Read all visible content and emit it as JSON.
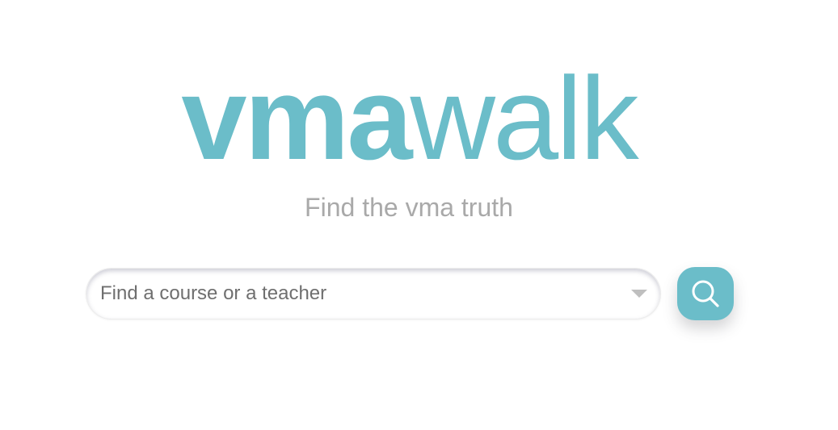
{
  "brand": {
    "logo_part_bold": "vma",
    "logo_part_regular": "walk",
    "tagline": "Find the vma truth",
    "accent_color": "#6bbdc9"
  },
  "search": {
    "placeholder": "Find a course or a teacher",
    "value": "",
    "dropdown_icon": "caret-down-icon",
    "button_icon": "search-icon"
  }
}
